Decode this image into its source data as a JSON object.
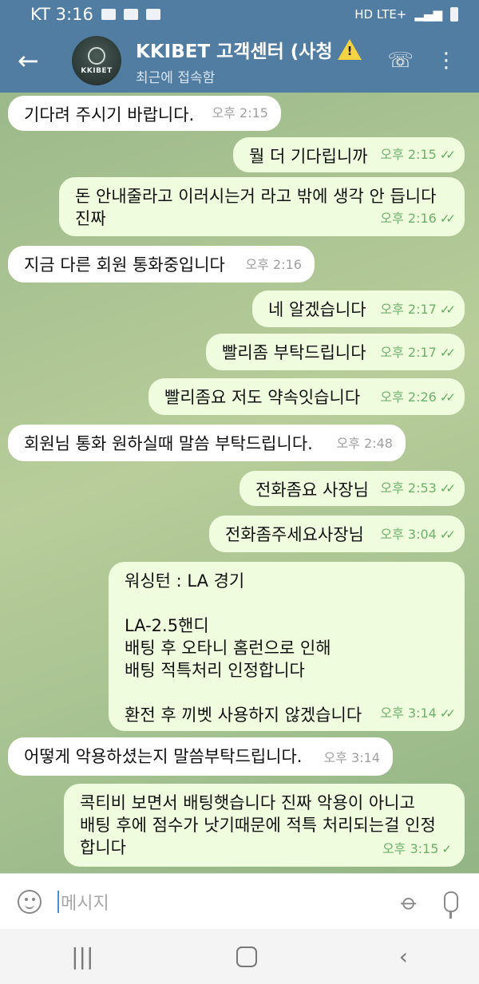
{
  "status_bar": {
    "carrier_time": "KT 3:16",
    "network": "HD LTE+",
    "signal": "▂▄▆"
  },
  "header": {
    "back_label": "←",
    "title": "KKIBET 고객센터 (사청",
    "warning_glyph": "!",
    "subtitle": "최근에 접속함",
    "avatar_text": "KKIBET",
    "call_label": "☏",
    "menu_label": "⋮"
  },
  "messages": [
    {
      "dir": "in",
      "text": "기다려 주시기 바랍니다.",
      "time": "오후 2:15"
    },
    {
      "dir": "out",
      "text": "뭘 더 기다립니까",
      "time": "오후 2:15",
      "read": true
    },
    {
      "dir": "out",
      "text": "돈 안내줄라고 이러시는거 라고 밖에 생각 안 듭니다\n진짜",
      "time": "오후 2:16",
      "read": true
    },
    {
      "dir": "in",
      "text": "지금 다른 회원 통화중입니다",
      "time": "오후 2:16"
    },
    {
      "dir": "out",
      "text": "네 알겠습니다",
      "time": "오후 2:17",
      "read": true
    },
    {
      "dir": "out",
      "text": "빨리좀 부탁드립니다",
      "time": "오후 2:17",
      "read": true
    },
    {
      "dir": "out",
      "text": "빨리좀요 저도 약속잇습니다",
      "time": "오후 2:26",
      "read": true
    },
    {
      "dir": "in",
      "text": "회원님 통화 원하실때 말씀 부탁드립니다.",
      "time": "오후 2:48"
    },
    {
      "dir": "out",
      "text": "전화좀요 사장님",
      "time": "오후 2:53",
      "read": true
    },
    {
      "dir": "out",
      "text": "전화좀주세요사장님",
      "time": "오후 3:04",
      "read": true
    },
    {
      "dir": "out",
      "text": "워싱턴 : LA 경기\n\nLA-2.5핸디\n배팅 후 오타니 홈런으로 인해\n배팅 적특처리 인정합니다\n\n환전 후 끼벳 사용하지 않겠습니다",
      "time": "오후 3:14",
      "read": true
    },
    {
      "dir": "in",
      "text": "어떻게 악용하셨는지 말씀부탁드립니다.",
      "time": "오후 3:14"
    },
    {
      "dir": "out",
      "text": "콕티비 보면서 배팅햇습니다 진짜 악용이 아니고\n배팅 후에 점수가 낫기때문에 적특 처리되는걸 인정\n합니다",
      "time": "오후 3:15",
      "read": false
    }
  ],
  "input": {
    "placeholder": "메시지"
  },
  "nav": {
    "recent": "|||",
    "back": "‹"
  },
  "colors": {
    "header": "#517da2",
    "bubble_out": "#effdde",
    "bubble_in": "#ffffff",
    "tick": "#5fae5a"
  }
}
